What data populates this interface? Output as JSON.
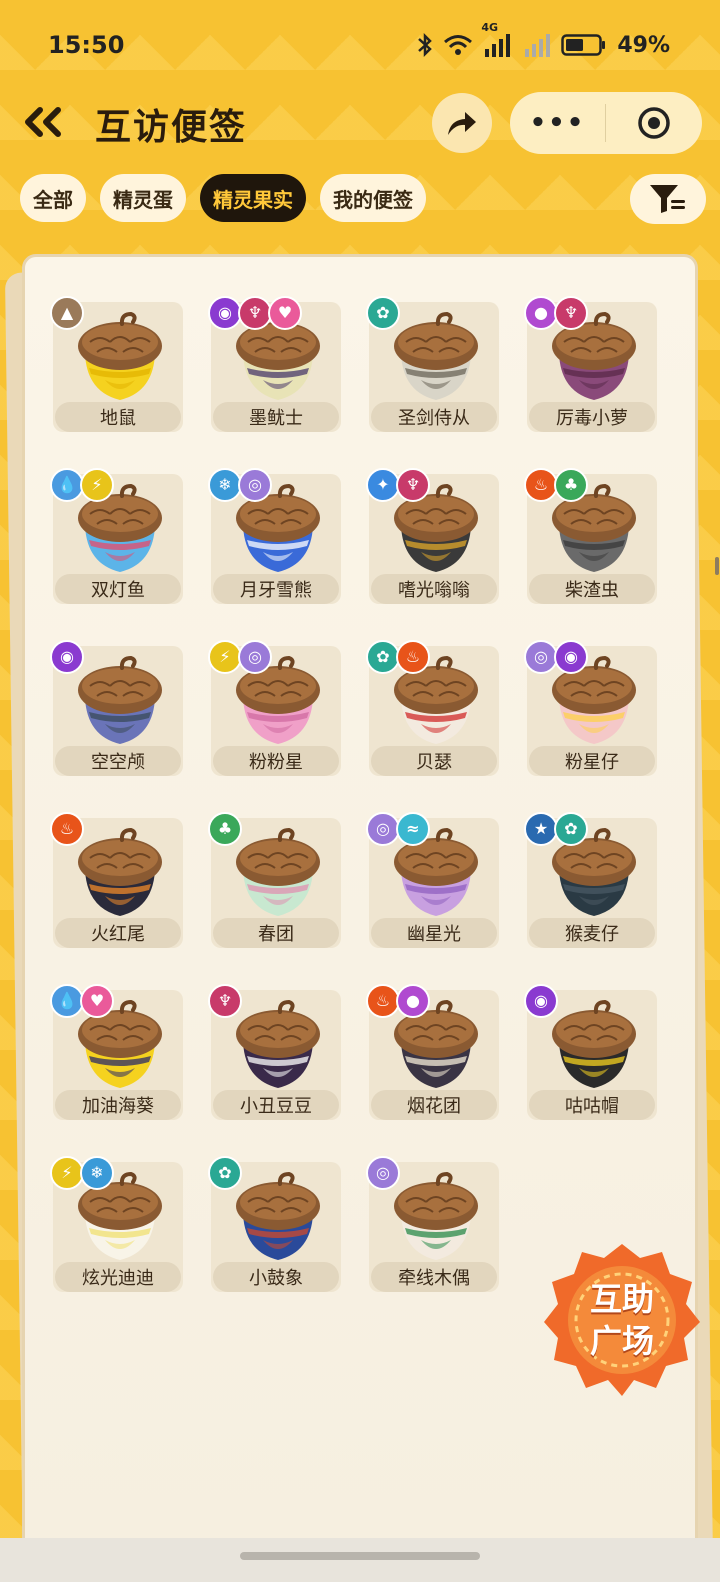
{
  "status_bar": {
    "time": "15:50",
    "network_label": "4G",
    "battery": "49%"
  },
  "header": {
    "title": "互访便签",
    "more_label": "•••"
  },
  "tabs": [
    {
      "label": "全部",
      "active": false
    },
    {
      "label": "精灵蛋",
      "active": false
    },
    {
      "label": "精灵果实",
      "active": true
    },
    {
      "label": "我的便签",
      "active": false
    }
  ],
  "items": [
    {
      "name": "地鼠",
      "badges": [
        "ground"
      ],
      "colors": [
        "#f5d21f",
        "#e1b300"
      ]
    },
    {
      "name": "墨鱿士",
      "badges": [
        "ghost",
        "demon",
        "fairy"
      ],
      "colors": [
        "#e8e3b6",
        "#4a3a6a"
      ]
    },
    {
      "name": "圣剑侍从",
      "badges": [
        "mech"
      ],
      "colors": [
        "#d9d5c8",
        "#6a6458"
      ]
    },
    {
      "name": "厉毒小萝",
      "badges": [
        "poison",
        "demon"
      ],
      "colors": [
        "#8a4a7a",
        "#5a2a4a"
      ]
    },
    {
      "name": "双灯鱼",
      "badges": [
        "water",
        "electric"
      ],
      "colors": [
        "#5cb4e8",
        "#e84a6a"
      ]
    },
    {
      "name": "月牙雪熊",
      "badges": [
        "ice",
        "wind"
      ],
      "colors": [
        "#3a6ad8",
        "#ffffff"
      ]
    },
    {
      "name": "嗜光嗡嗡",
      "badges": [
        "light",
        "demon"
      ],
      "colors": [
        "#3a3a3a",
        "#e0a82a"
      ]
    },
    {
      "name": "柴渣虫",
      "badges": [
        "fire",
        "grass"
      ],
      "colors": [
        "#6a6a6a",
        "#3a3a3a"
      ]
    },
    {
      "name": "空空颅",
      "badges": [
        "ghost"
      ],
      "colors": [
        "#6a74b8",
        "#3a4a5a"
      ]
    },
    {
      "name": "粉粉星",
      "badges": [
        "electric",
        "wind"
      ],
      "colors": [
        "#f0a0c8",
        "#d06aa0"
      ]
    },
    {
      "name": "贝瑟",
      "badges": [
        "mech",
        "fire"
      ],
      "colors": [
        "#f3eadf",
        "#d02a2a"
      ]
    },
    {
      "name": "粉星仔",
      "badges": [
        "wind",
        "ghost"
      ],
      "colors": [
        "#f4c8c8",
        "#ffd24a"
      ]
    },
    {
      "name": "火红尾",
      "badges": [
        "fire"
      ],
      "colors": [
        "#2a2a3a",
        "#f08a2a"
      ]
    },
    {
      "name": "春团",
      "badges": [
        "grass"
      ],
      "colors": [
        "#c8e8d0",
        "#e090b0"
      ]
    },
    {
      "name": "幽星光",
      "badges": [
        "wind",
        "flying"
      ],
      "colors": [
        "#c8a0e0",
        "#9060c0"
      ]
    },
    {
      "name": "猴麦仔",
      "badges": [
        "star",
        "mech"
      ],
      "colors": [
        "#2a3a44",
        "#4a5a64"
      ]
    },
    {
      "name": "加油海葵",
      "badges": [
        "water",
        "fairy"
      ],
      "colors": [
        "#f5d21f",
        "#2a2a6a"
      ]
    },
    {
      "name": "小丑豆豆",
      "badges": [
        "demon"
      ],
      "colors": [
        "#3a2a4a",
        "#ffffff"
      ]
    },
    {
      "name": "烟花团",
      "badges": [
        "fire",
        "poison"
      ],
      "colors": [
        "#3a3444",
        "#f5ecd8"
      ]
    },
    {
      "name": "咕咕帽",
      "badges": [
        "ghost"
      ],
      "colors": [
        "#2a2a2a",
        "#f5d21f"
      ]
    },
    {
      "name": "炫光迪迪",
      "badges": [
        "electric",
        "ice"
      ],
      "colors": [
        "#f8f4e8",
        "#f0e070"
      ]
    },
    {
      "name": "小鼓象",
      "badges": [
        "mech"
      ],
      "colors": [
        "#2a4a9a",
        "#d04a2a"
      ]
    },
    {
      "name": "牵线木偶",
      "badges": [
        "wind"
      ],
      "colors": [
        "#f3eadf",
        "#2a8a4a"
      ]
    }
  ],
  "badge_types": {
    "ground": {
      "color": "#9a7a5a",
      "glyph": "▲"
    },
    "ghost": {
      "color": "#8a3ad0",
      "glyph": "◉"
    },
    "demon": {
      "color": "#c83a6a",
      "glyph": "♆"
    },
    "fairy": {
      "color": "#ea5a9a",
      "glyph": "♥"
    },
    "mech": {
      "color": "#2aa894",
      "glyph": "✿"
    },
    "poison": {
      "color": "#b04ad0",
      "glyph": "●"
    },
    "water": {
      "color": "#4a9ae0",
      "glyph": "💧"
    },
    "electric": {
      "color": "#e8c41a",
      "glyph": "⚡"
    },
    "ice": {
      "color": "#3a9ad8",
      "glyph": "❄"
    },
    "wind": {
      "color": "#9a7ad8",
      "glyph": "◎"
    },
    "light": {
      "color": "#3a8ae0",
      "glyph": "✦"
    },
    "fire": {
      "color": "#e8541a",
      "glyph": "♨"
    },
    "grass": {
      "color": "#3aa85a",
      "glyph": "♣"
    },
    "flying": {
      "color": "#3ab8d0",
      "glyph": "≈"
    },
    "star": {
      "color": "#2a6ab0",
      "glyph": "★"
    }
  },
  "assist": {
    "line1": "互助",
    "line2": "广场"
  }
}
